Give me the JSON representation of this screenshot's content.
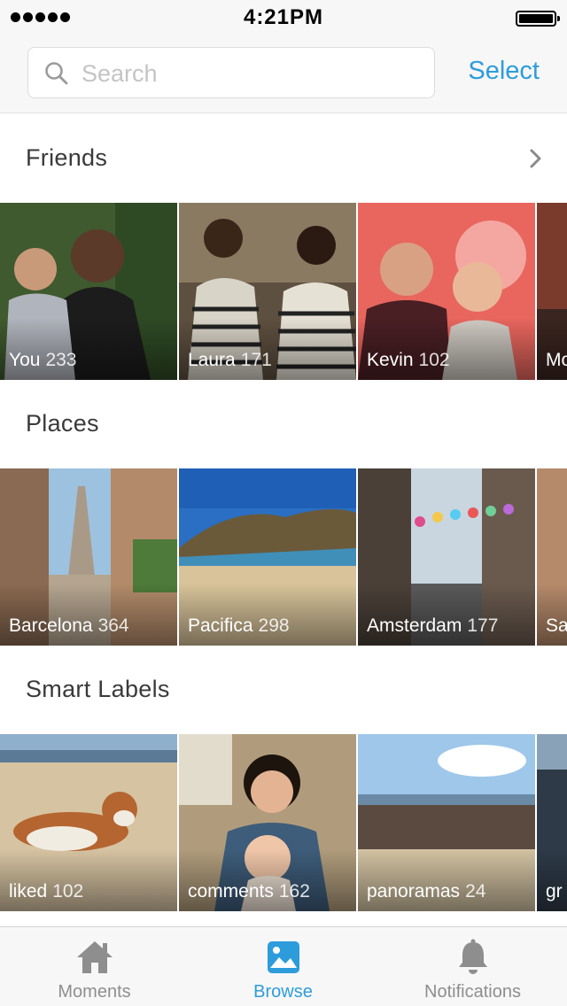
{
  "status_bar": {
    "time": "4:21PM"
  },
  "search": {
    "placeholder": "Search",
    "select_label": "Select"
  },
  "sections": [
    {
      "title": "Friends",
      "tiles": [
        {
          "name": "You",
          "count": "233"
        },
        {
          "name": "Laura",
          "count": "171"
        },
        {
          "name": "Kevin",
          "count": "102"
        },
        {
          "name": "Mo",
          "count": ""
        }
      ]
    },
    {
      "title": "Places",
      "tiles": [
        {
          "name": "Barcelona",
          "count": "364"
        },
        {
          "name": "Pacifica",
          "count": "298"
        },
        {
          "name": "Amsterdam",
          "count": "177"
        },
        {
          "name": "Sa",
          "count": ""
        }
      ]
    },
    {
      "title": "Smart Labels",
      "tiles": [
        {
          "name": "liked",
          "count": "102"
        },
        {
          "name": "comments",
          "count": "162"
        },
        {
          "name": "panoramas",
          "count": "24"
        },
        {
          "name": "gr",
          "count": ""
        }
      ]
    }
  ],
  "tab_bar": {
    "tabs": [
      {
        "label": "Moments",
        "icon": "home-icon"
      },
      {
        "label": "Browse",
        "icon": "photo-icon"
      },
      {
        "label": "Notifications",
        "icon": "bell-icon"
      }
    ],
    "active": "Browse"
  },
  "colors": {
    "accent": "#2d9cdb",
    "inactive": "#8e8e8e",
    "bar_background": "#f7f7f7"
  }
}
